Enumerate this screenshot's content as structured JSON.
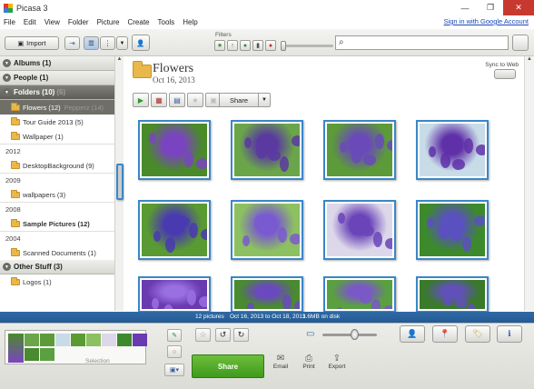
{
  "app": {
    "title": "Picasa 3"
  },
  "window_controls": {
    "minimize": "—",
    "restore": "❐",
    "close": "✕"
  },
  "menu": [
    "File",
    "Edit",
    "View",
    "Folder",
    "Picture",
    "Create",
    "Tools",
    "Help"
  ],
  "signin": "Sign in with Google Account",
  "toolbar": {
    "import_label": "Import",
    "filters_label": "Filters"
  },
  "sidebar": {
    "albums": "Albums (1)",
    "people": "People (1)",
    "folders": "Folders (10)",
    "folders_ghost": "(6)",
    "flowers": "Flowers (12)",
    "flowers_ghost": "Pepperz (14)",
    "tour_guide": "Tour Guide 2013 (5)",
    "wallpaper": "Wallpaper (1)",
    "year_2012": "2012",
    "desktop_bg": "DesktopBackground (9)",
    "year_2009": "2009",
    "wallpapers": "wallpapers (3)",
    "year_2008": "2008",
    "sample_pictures": "Sample Pictures (12)",
    "year_2004": "2004",
    "scanned_docs": "Scanned Documents (1)",
    "other_stuff": "Other Stuff (3)",
    "logos": "Logos (1)"
  },
  "album": {
    "title": "Flowers",
    "date": "Oct 16, 2013",
    "sync_label": "Sync to Web",
    "share_label": "Share"
  },
  "photos": [
    {
      "bg": "#4a8a2a",
      "fg": "#7a44c0"
    },
    {
      "bg": "#6aa54a",
      "fg": "#5a3aa0"
    },
    {
      "bg": "#5c9a3a",
      "fg": "#6a4ab8"
    },
    {
      "bg": "#c8dce8",
      "fg": "#6030a8"
    },
    {
      "bg": "#5a9a32",
      "fg": "#4a3ab0"
    },
    {
      "bg": "#8cc060",
      "fg": "#7a5ad0"
    },
    {
      "bg": "#dcd8ea",
      "fg": "#6a44b8"
    },
    {
      "bg": "#3c8a2c",
      "fg": "#5a50c0"
    },
    {
      "bg": "#6a3ab0",
      "fg": "#9a70e0"
    },
    {
      "bg": "#4a8a30",
      "fg": "#6a48c0"
    },
    {
      "bg": "#5aa040",
      "fg": "#7a58c8"
    },
    {
      "bg": "#3a7a2a",
      "fg": "#6050b8"
    }
  ],
  "status": {
    "count": "12 pictures",
    "range": "Oct 16, 2013 to Oct 18, 2013",
    "size": "1.6MB on disk"
  },
  "tray": {
    "caption": "Selection",
    "share_label": "Share",
    "email_label": "Email",
    "print_label": "Print",
    "export_label": "Export"
  },
  "colors": {
    "accent": "#2f6aa5",
    "selection_border": "#3a86c8",
    "share_green": "#4fa82a"
  }
}
